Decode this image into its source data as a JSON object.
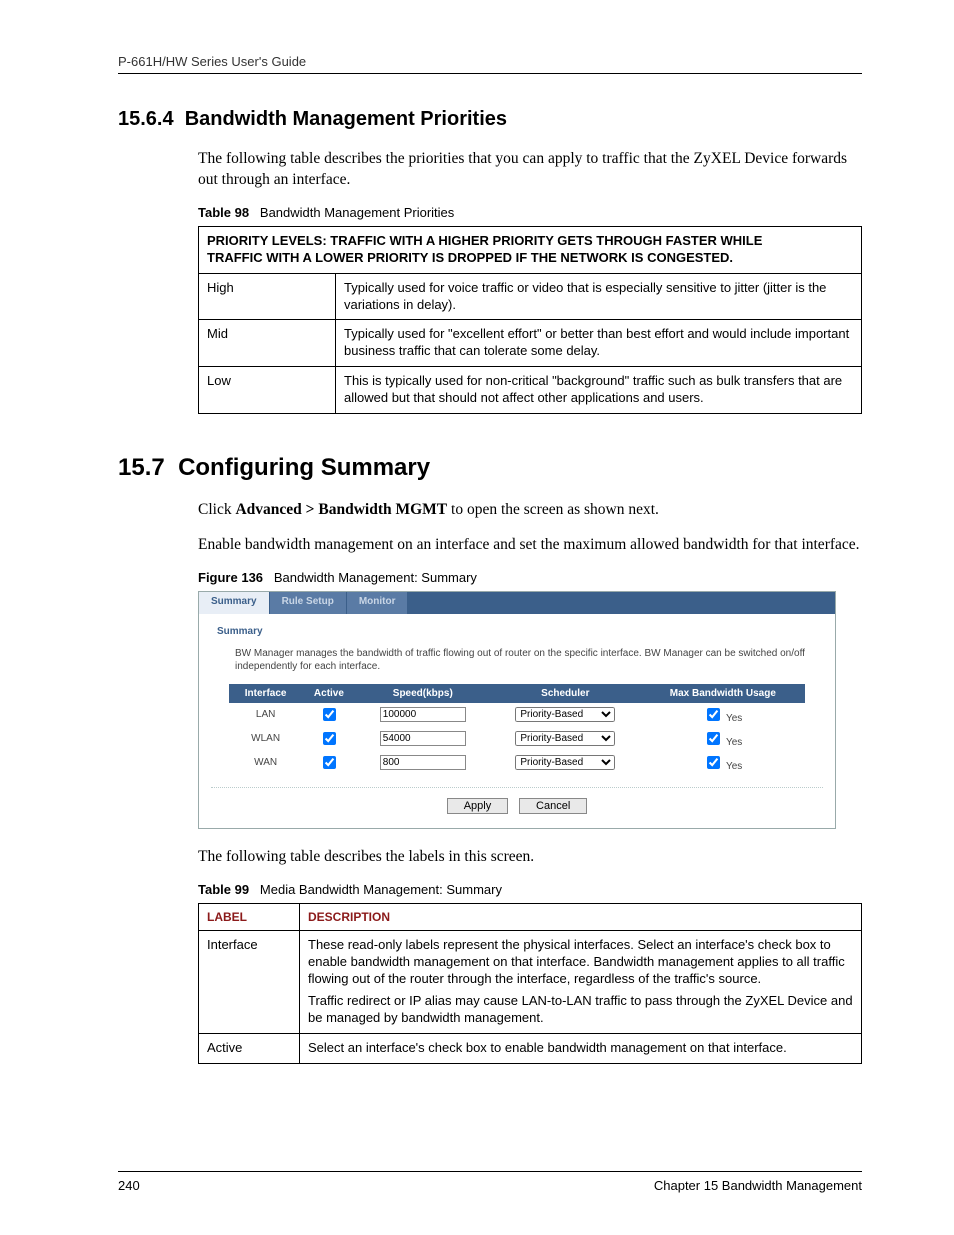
{
  "runningHeader": "P-661H/HW Series User's Guide",
  "section1": {
    "number": "15.6.4",
    "title": "Bandwidth Management Priorities",
    "intro": "The following table describes the priorities that you can apply to traffic that the ZyXEL Device forwards out through an interface."
  },
  "table98": {
    "captionBold": "Table 98",
    "captionRest": "Bandwidth Management Priorities",
    "headerLine1": "PRIORITY LEVELS: TRAFFIC WITH A HIGHER PRIORITY GETS THROUGH FASTER WHILE",
    "headerLine2": "TRAFFIC WITH A LOWER PRIORITY IS DROPPED IF THE NETWORK IS CONGESTED.",
    "rows": [
      {
        "label": "High",
        "desc": "Typically used for voice traffic or video that is especially sensitive to jitter (jitter is the variations in delay)."
      },
      {
        "label": "Mid",
        "desc": "Typically used for \"excellent effort\" or better than best effort and would include important business traffic that can tolerate some delay."
      },
      {
        "label": "Low",
        "desc": "This is typically used for non-critical \"background\" traffic such as bulk transfers that are allowed but that should not affect other applications and users."
      }
    ]
  },
  "section2": {
    "number": "15.7",
    "title": "Configuring Summary",
    "line1a": "Click ",
    "line1b": "Advanced > Bandwidth MGMT",
    "line1c": " to open the screen as shown next.",
    "line2": "Enable bandwidth management on an interface and set the maximum allowed bandwidth for that interface."
  },
  "figure136": {
    "captionBold": "Figure 136",
    "captionRest": "Bandwidth Management: Summary",
    "tabs": {
      "t1": "Summary",
      "t2": "Rule Setup",
      "t3": "Monitor"
    },
    "panelTitle": "Summary",
    "panelDesc": "BW Manager manages the bandwidth of traffic flowing out of router on the specific interface. BW Manager can be switched on/off independently for each interface.",
    "headers": {
      "c1": "Interface",
      "c2": "Active",
      "c3": "Speed(kbps)",
      "c4": "Scheduler",
      "c5": "Max Bandwidth Usage"
    },
    "rows": [
      {
        "iface": "LAN",
        "speed": "100000",
        "sched": "Priority-Based",
        "mbu": "Yes"
      },
      {
        "iface": "WLAN",
        "speed": "54000",
        "sched": "Priority-Based",
        "mbu": "Yes"
      },
      {
        "iface": "WAN",
        "speed": "800",
        "sched": "Priority-Based",
        "mbu": "Yes"
      }
    ],
    "apply": "Apply",
    "cancel": "Cancel"
  },
  "afterFigure": "The following table describes the labels in this screen.",
  "table99": {
    "captionBold": "Table 99",
    "captionRest": "Media Bandwidth Management: Summary",
    "head1": "LABEL",
    "head2": "DESCRIPTION",
    "rows": [
      {
        "label": "Interface",
        "p1": "These read-only labels represent the physical interfaces. Select an interface's check box to enable bandwidth management on that interface. Bandwidth management applies to all traffic flowing out of the router through the interface, regardless of the traffic's source.",
        "p2": "Traffic redirect or IP alias may cause LAN-to-LAN traffic to pass through the ZyXEL Device and be managed by bandwidth management."
      },
      {
        "label": "Active",
        "p1": "Select an interface's check box to enable bandwidth management on that interface.",
        "p2": ""
      }
    ]
  },
  "footer": {
    "pageNum": "240",
    "chapter": "Chapter 15 Bandwidth Management"
  }
}
